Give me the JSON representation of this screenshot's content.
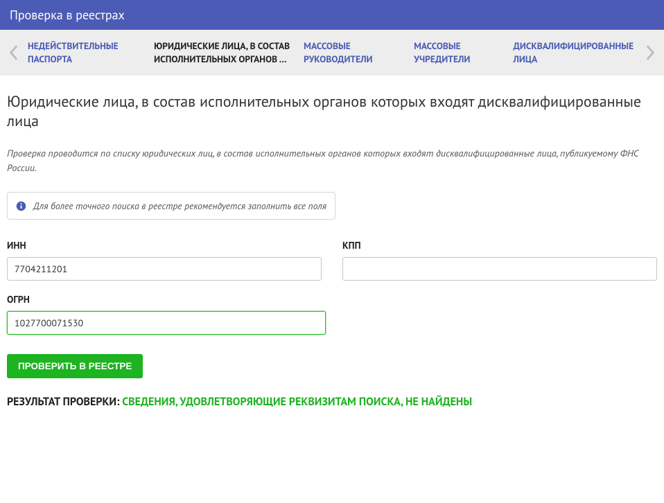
{
  "header": {
    "title": "Проверка в реестрах"
  },
  "tabs": [
    {
      "label": "НЕДЕЙСТВИТЕЛЬНЫЕ ПАСПОРТА",
      "active": false
    },
    {
      "label": "ЮРИДИЧЕСКИЕ ЛИЦА, В СОСТАВ ИСПОЛНИТЕЛЬНЫХ ОРГАНОВ …",
      "active": true
    },
    {
      "label": "МАССОВЫЕ РУКОВОДИТЕЛИ",
      "active": false
    },
    {
      "label": "МАССОВЫЕ УЧРЕДИТЕЛИ",
      "active": false
    },
    {
      "label": "ДИСКВАЛИФИЦИРОВАННЫЕ ЛИЦА",
      "active": false
    }
  ],
  "page": {
    "title": "Юридические лица, в состав исполнительных органов которых входят дисквалифицированные лица",
    "description": "Проверка проводится по списку юридических лиц, в состав исполнительных органов которых входят дисквалифицированные лица, публикуемому ФНС России.",
    "info": "Для более точного поиска в реестре рекомендуется заполнить все поля"
  },
  "form": {
    "inn_label": "ИНН",
    "inn_value": "7704211201",
    "kpp_label": "КПП",
    "kpp_value": "",
    "ogrn_label": "ОГРН",
    "ogrn_value": "1027700071530",
    "submit_label": "ПРОВЕРИТЬ В РЕЕСТРЕ"
  },
  "result": {
    "label": "РЕЗУЛЬТАТ ПРОВЕРКИ: ",
    "value": "СВЕДЕНИЯ, УДОВЛЕТВОРЯЮЩИЕ РЕКВИЗИТАМ ПОИСКА, НЕ НАЙДЕНЫ"
  }
}
